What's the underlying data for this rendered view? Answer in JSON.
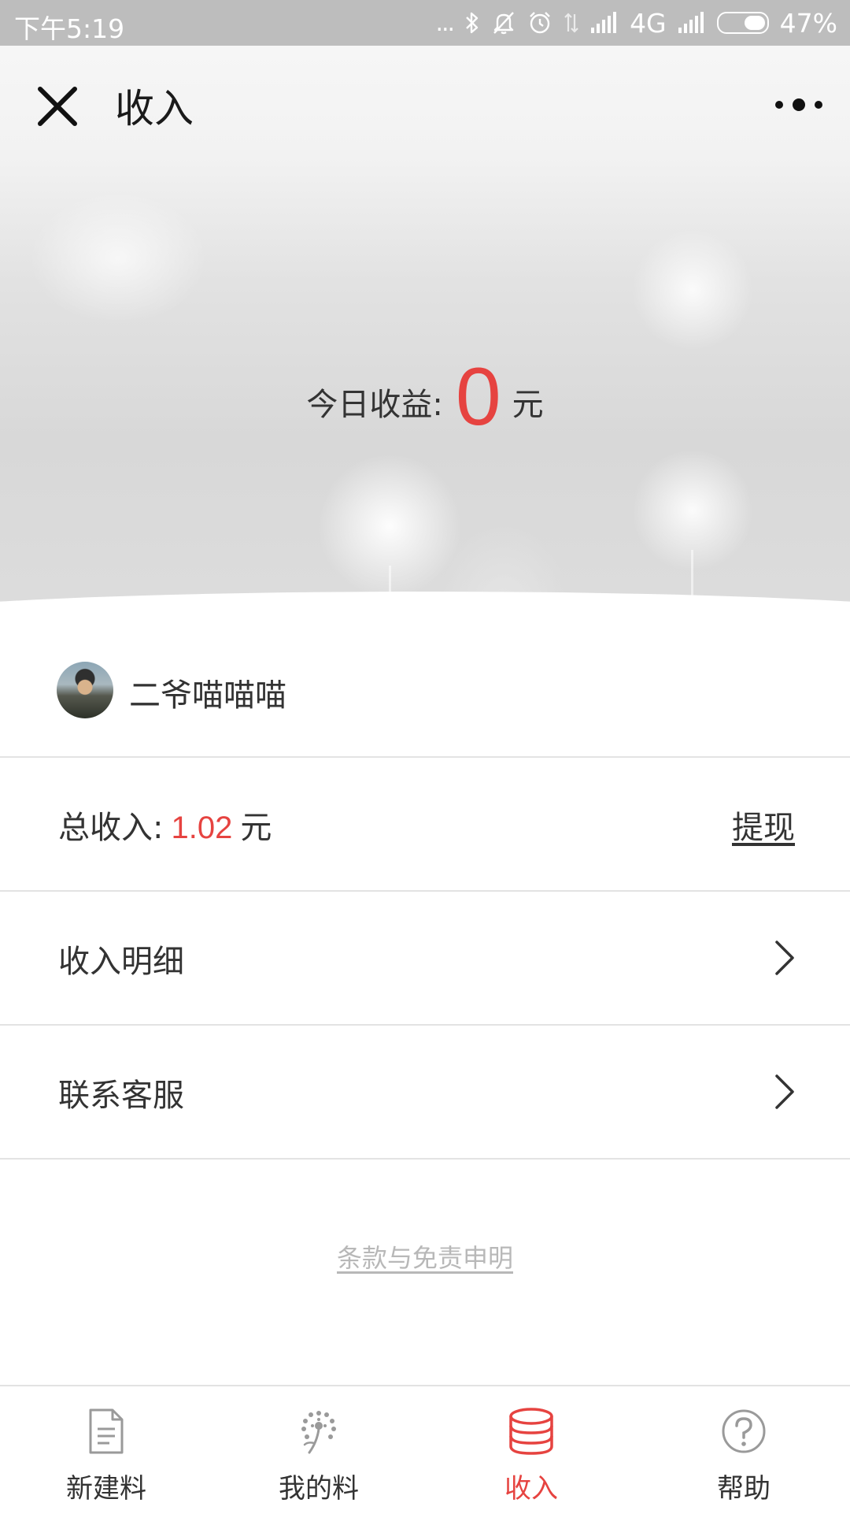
{
  "status_bar": {
    "time": "下午5:19",
    "more": "...",
    "network": "4G",
    "battery_percent": "47%",
    "battery_level": 0.47,
    "icons": [
      "bluetooth-icon",
      "mute-icon",
      "alarm-icon",
      "data-arrows-icon",
      "signal-icon",
      "signal-icon",
      "battery-icon"
    ]
  },
  "header": {
    "title": "收入",
    "close_icon": "close-icon",
    "more_icon": "more-icon"
  },
  "hero": {
    "today_label": "今日收益:",
    "today_value": "0",
    "today_unit": "元"
  },
  "user": {
    "name": "二爷喵喵喵"
  },
  "income": {
    "label": "总收入:",
    "amount": "1.02",
    "unit": "元",
    "withdraw": "提现"
  },
  "menu": [
    {
      "label": "收入明细",
      "icon": "chevron-right-icon"
    },
    {
      "label": "联系客服",
      "icon": "chevron-right-icon"
    }
  ],
  "footer": {
    "terms": "条款与免责申明"
  },
  "tabbar": {
    "tabs": [
      {
        "label": "新建料",
        "icon": "document-icon",
        "active": false
      },
      {
        "label": "我的料",
        "icon": "dandelion-icon",
        "active": false
      },
      {
        "label": "收入",
        "icon": "coins-icon",
        "active": true
      },
      {
        "label": "帮助",
        "icon": "help-icon",
        "active": false
      }
    ]
  },
  "colors": {
    "accent": "#e64340",
    "text": "#333333",
    "divider": "#e3e3e3",
    "status_bar": "#bdbdbd",
    "muted": "#b8b8b8"
  }
}
